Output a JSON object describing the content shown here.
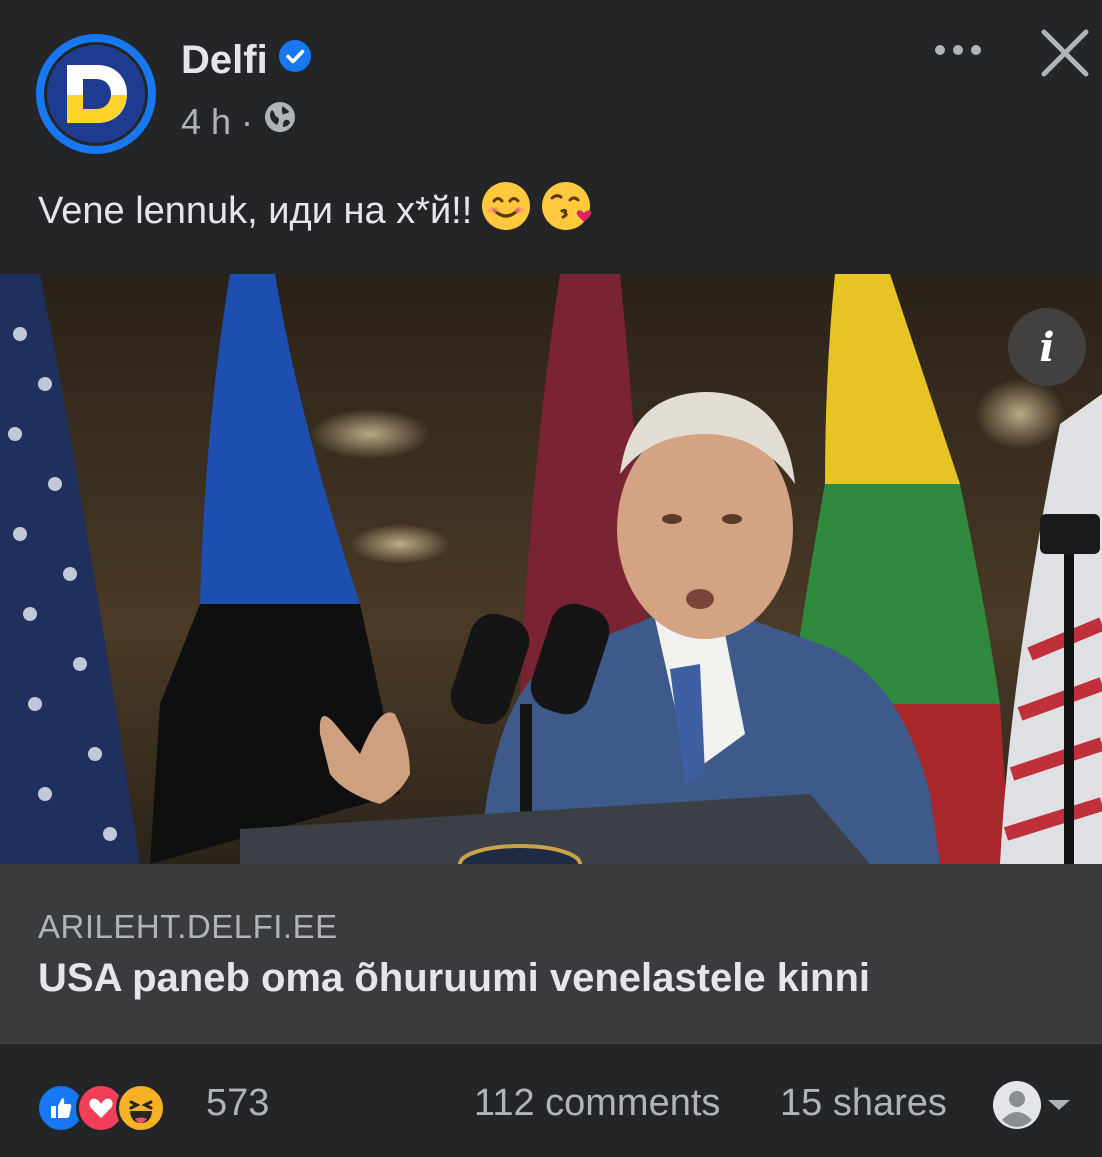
{
  "post": {
    "page_name": "Delfi",
    "verified": true,
    "time": "4 h",
    "separator": "·",
    "text": "Vene lennuk, иди на х*й!!",
    "emojis": [
      "smiling-face-icon",
      "face-blowing-kiss-icon"
    ]
  },
  "link": {
    "domain": "ARILEHT.DELFI.EE",
    "title": "USA paneb oma õhuruumi venelastele kinni"
  },
  "footer": {
    "reaction_count": "573",
    "comments": "112 comments",
    "shares": "15 shares",
    "reactions": [
      "like-icon",
      "love-icon",
      "haha-icon"
    ]
  },
  "colors": {
    "background": "#242526",
    "link_box": "#3a3b3c",
    "brand": "#1877f2",
    "secondary_text": "#b0b3b8"
  }
}
